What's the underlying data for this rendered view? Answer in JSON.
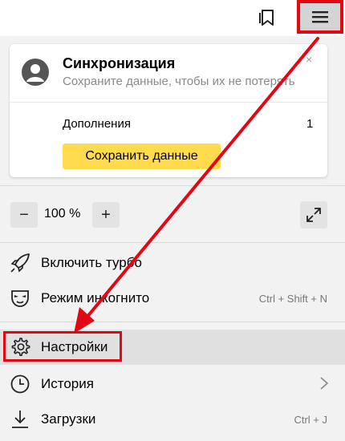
{
  "sync": {
    "title": "Синхронизация",
    "subtitle": "Сохраните данные, чтобы их не потерять",
    "close_icon": "×",
    "addons_label": "Дополнения",
    "addons_count": "1",
    "save_label": "Сохранить данные"
  },
  "zoom": {
    "minus": "−",
    "value": "100 %",
    "plus": "+"
  },
  "menu": {
    "turbo": "Включить турбо",
    "incognito": "Режим инкогнито",
    "incognito_shortcut": "Ctrl + Shift + N",
    "settings": "Настройки",
    "history": "История",
    "downloads": "Загрузки",
    "downloads_shortcut": "Ctrl + J"
  },
  "colors": {
    "accent_red": "#e30613",
    "save_button": "#ffdb4d",
    "panel_bg": "#f2f2f2"
  },
  "icons": [
    "bookmarks-icon",
    "hamburger-menu-icon",
    "avatar-icon",
    "fullscreen-icon",
    "rocket-icon",
    "incognito-mask-icon",
    "gear-icon",
    "clock-icon",
    "download-icon",
    "chevron-right-icon"
  ]
}
